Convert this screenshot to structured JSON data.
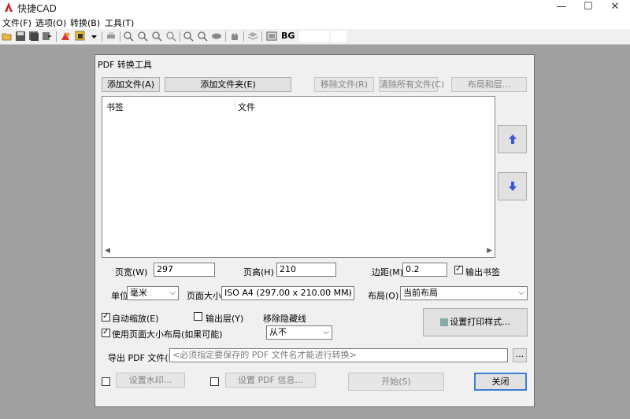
{
  "window": {
    "title": "快捷CAD",
    "minimize": "—",
    "maximize": "☐",
    "close": "✕"
  },
  "menu": [
    "文件(F)",
    "选项(O)",
    "转换(B)",
    "工具(T)"
  ],
  "toolbar": {
    "bg_label": "BG"
  },
  "dialog": {
    "title": "PDF 转换工具",
    "buttons": {
      "add_file": "添加文件(A)",
      "add_folder": "添加文件夹(E)",
      "remove_file": "移除文件(R)",
      "clear_files": "清除所有文件(C)",
      "layout_layers": "布局和层...",
      "print_style": "设置打印样式...",
      "browse": "...",
      "watermark": "设置水印...",
      "pdf_info": "设置 PDF 信息...",
      "start": "开始(S)",
      "close": "关闭"
    },
    "list": {
      "col_bookmark": "书签",
      "col_file": "文件"
    },
    "page_width": {
      "label": "页宽(W)",
      "value": "297"
    },
    "page_height": {
      "label": "页高(H)",
      "value": "210"
    },
    "margin": {
      "label": "边距(M)",
      "value": "0.2"
    },
    "output_bookmarks": {
      "label": "输出书签",
      "checked": true
    },
    "unit": {
      "label": "单位",
      "value": "毫米"
    },
    "page_size": {
      "label": "页面大小",
      "value": "ISO A4 (297.00 x 210.00 MM)"
    },
    "layout": {
      "label": "布局(O)",
      "value": "当前布局"
    },
    "auto_zoom": {
      "label": "自动缩放(E)",
      "checked": true
    },
    "output_layers": {
      "label": "输出层(Y)",
      "checked": false
    },
    "use_page_layout": {
      "label": "使用页面大小布局(如果可能)",
      "checked": true
    },
    "remove_hidden": {
      "label": "移除隐藏线",
      "value": "从不"
    },
    "export_pdf": {
      "label": "导出 PDF 文件(P)",
      "placeholder": "<必须指定要保存的 PDF 文件名才能进行转换>"
    }
  }
}
